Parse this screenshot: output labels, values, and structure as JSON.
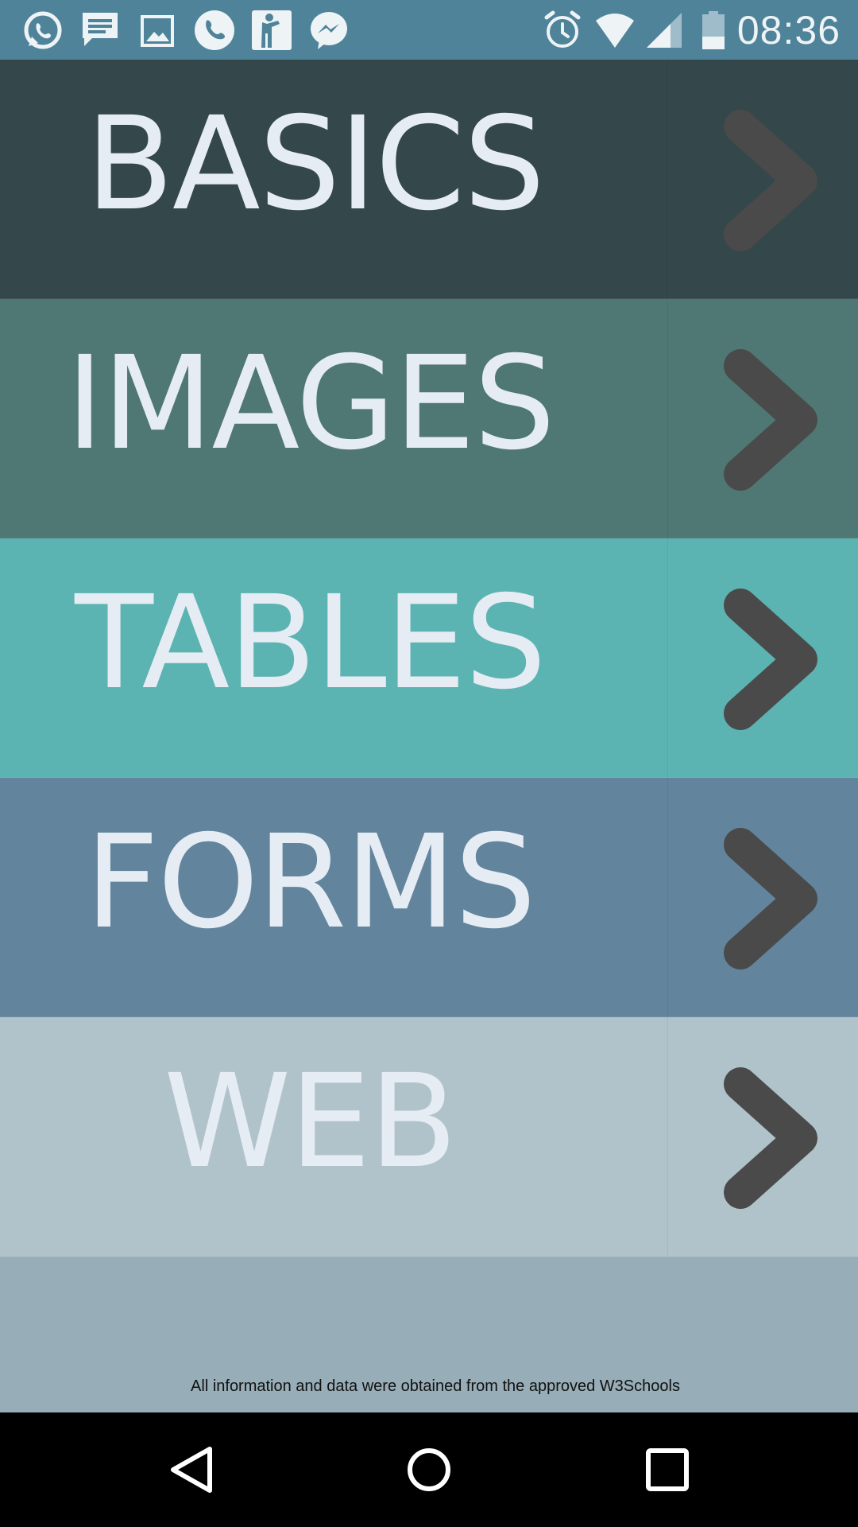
{
  "status_bar": {
    "time": "08:36",
    "left_icons": [
      "whatsapp-icon",
      "message-icon",
      "gallery-icon",
      "phone-icon",
      "accessibility-icon",
      "messenger-icon"
    ],
    "right_icons": [
      "alarm-icon",
      "wifi-icon",
      "signal-icon",
      "battery-icon"
    ],
    "background": "#4f8399"
  },
  "menu": {
    "items": [
      {
        "label": "BASICS",
        "color": "#34474b",
        "panel_color": "#34474b"
      },
      {
        "label": "IMAGES",
        "color": "#4f7774",
        "panel_color": "#4f7774"
      },
      {
        "label": "TABLES",
        "color": "#5bb4b2",
        "panel_color": "#5bb4b2"
      },
      {
        "label": "FORMS",
        "color": "#62849d",
        "panel_color": "#62849d"
      },
      {
        "label": "WEB",
        "color": "#b1c3ca",
        "panel_color": "#b1c3ca"
      }
    ],
    "text_color": "#e6ecf3",
    "chevron_color": "#4a4a4a",
    "chevron_icon": "chevron-right-icon"
  },
  "footer": {
    "text": "All information and data were obtained from the approved W3Schools"
  },
  "nav_bar": {
    "buttons": [
      "back-icon",
      "home-icon",
      "recents-icon"
    ]
  }
}
